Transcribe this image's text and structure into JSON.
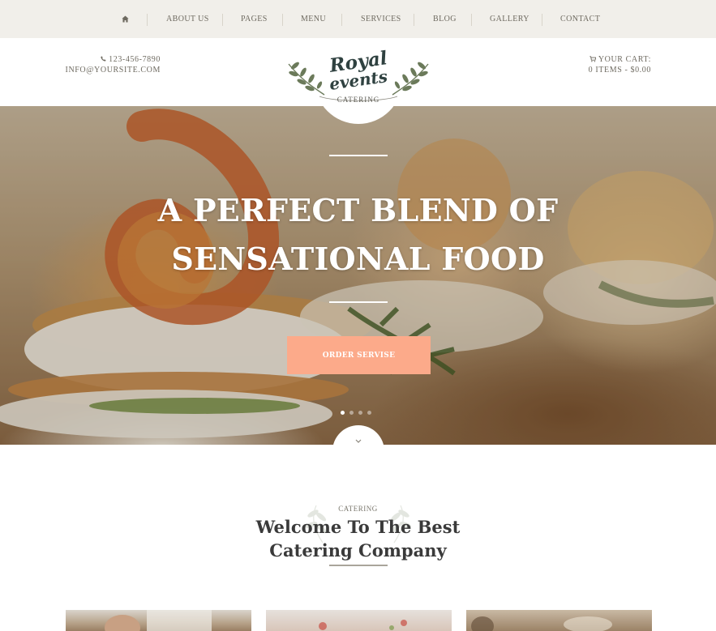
{
  "nav": {
    "items": [
      "ABOUT US",
      "PAGES",
      "MENU",
      "SERVICES",
      "BLOG",
      "GALLERY",
      "CONTACT"
    ],
    "home_icon": "home-icon"
  },
  "header": {
    "phone": "123-456-7890",
    "email": "INFO@YOURSITE.COM",
    "cart_label": "YOUR CART:",
    "cart_summary": "0 ITEMS - $0.00",
    "phone_icon": "phone-icon",
    "cart_icon": "cart-icon"
  },
  "logo": {
    "line1": "Royal",
    "line2": "events",
    "tagline": "CATERING"
  },
  "hero": {
    "title_line1": "A PERFECT BLEND OF",
    "title_line2": "SENSATIONAL FOOD",
    "button_label": "ORDER SERVISE",
    "slide_count": 4,
    "active_slide": 1
  },
  "welcome": {
    "eyebrow": "CATERING",
    "title_line1": "Welcome To The Best",
    "title_line2": "Catering Company"
  },
  "colors": {
    "accent": "#fcaa8a",
    "nav_bg": "#f1efea",
    "logo_green": "#2f4140",
    "leaf_green": "#6b7a5a"
  }
}
